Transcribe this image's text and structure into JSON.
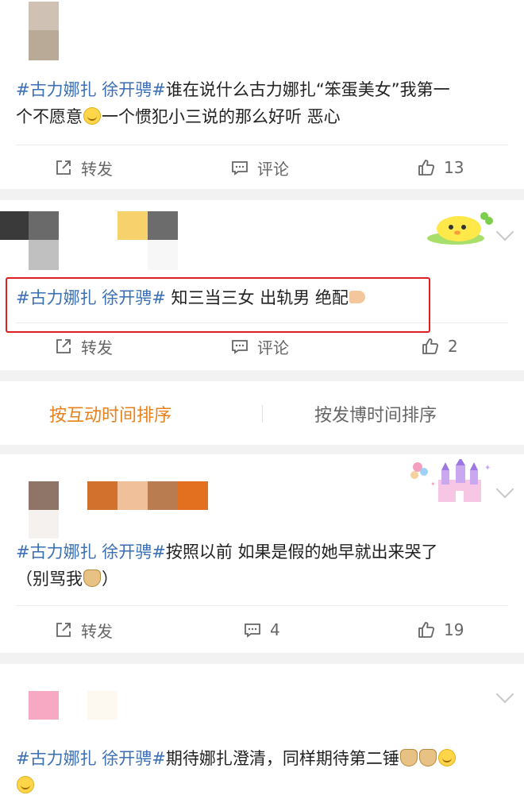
{
  "posts": [
    {
      "hashtag": "#古力娜扎 徐开骋#",
      "body_line1": "谁在说什么古力娜扎“笨蛋美女”我第一",
      "body_line2_a": "个不愿意",
      "emoji2": "smile",
      "body_line2_b": "一个惯犯小三说的那么好听 恶心",
      "repost_label": "转发",
      "comment_label": "评论",
      "likes": "13"
    },
    {
      "hashtag": "#古力娜扎 徐开骋#",
      "body_line1": " 知三当三女 出轨男 绝配",
      "emoji": "praying-hands",
      "repost_label": "转发",
      "comment_label": "评论",
      "likes": "2"
    },
    {
      "hashtag": "#古力娜扎 徐开骋#",
      "body_line1": "按照以前 如果是假的她早就出来哭了",
      "body_line2_a": "（别骂我",
      "emoji2": "doge",
      "body_line2_b": "）",
      "repost_label": "转发",
      "comments": "4",
      "likes": "19"
    },
    {
      "hashtag": "#古力娜扎 徐开骋#",
      "body_line1": "期待娜扎澄清，同样期待第二锤",
      "emojis": [
        "doge",
        "doge",
        "smile",
        "smile"
      ]
    }
  ],
  "sort_bar": {
    "active": "按互动时间排序",
    "inactive": "按发博时间排序",
    "active_color": "#e8801c"
  },
  "icons": [
    "repost-icon",
    "comment-icon",
    "like-icon",
    "chevron-down-icon"
  ]
}
